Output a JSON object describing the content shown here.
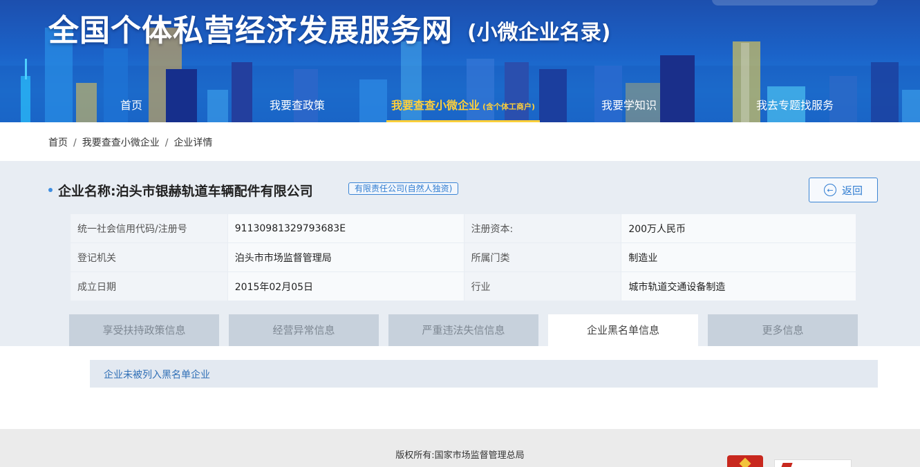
{
  "header": {
    "title": "全国个体私营经济发展服务网",
    "subtitle": "(小微企业名录)"
  },
  "nav": {
    "items": [
      {
        "label": "首页"
      },
      {
        "label": "我要查政策"
      },
      {
        "label": "我要查查小微企业",
        "note": "(含个体工商户)",
        "active": true
      },
      {
        "label": "我要学知识"
      },
      {
        "label": "我去专题找服务"
      }
    ]
  },
  "breadcrumb": [
    "首页",
    "我要查查小微企业",
    "企业详情"
  ],
  "company": {
    "label": "企业名称:",
    "name": "泊头市银赫轨道车辆配件有限公司",
    "type": "有限责任公司(自然人独资)"
  },
  "back_label": "返回",
  "info": {
    "rows": [
      {
        "k1": "统一社会信用代码/注册号",
        "v1": "91130981329793683E",
        "k2": "注册资本:",
        "v2": "200万人民币"
      },
      {
        "k1": "登记机关",
        "v1": "泊头市市场监督管理局",
        "k2": "所属门类",
        "v2": "制造业"
      },
      {
        "k1": "成立日期",
        "v1": "2015年02月05日",
        "k2": "行业",
        "v2": "城市轨道交通设备制造"
      }
    ]
  },
  "tabs": [
    {
      "label": "享受扶持政策信息"
    },
    {
      "label": "经营异常信息"
    },
    {
      "label": "严重违法失信信息"
    },
    {
      "label": "企业黑名单信息",
      "active": true
    },
    {
      "label": "更多信息"
    }
  ],
  "result_text": "企业未被列入黑名单企业",
  "footer": {
    "copyright": "版权所有:国家市场监督管理总局"
  },
  "colors": {
    "header_blue": "#1b63c9",
    "nav_active": "#ffcf3a",
    "accent_blue": "#2f7cd1",
    "panel_bg": "#e8edf3"
  }
}
